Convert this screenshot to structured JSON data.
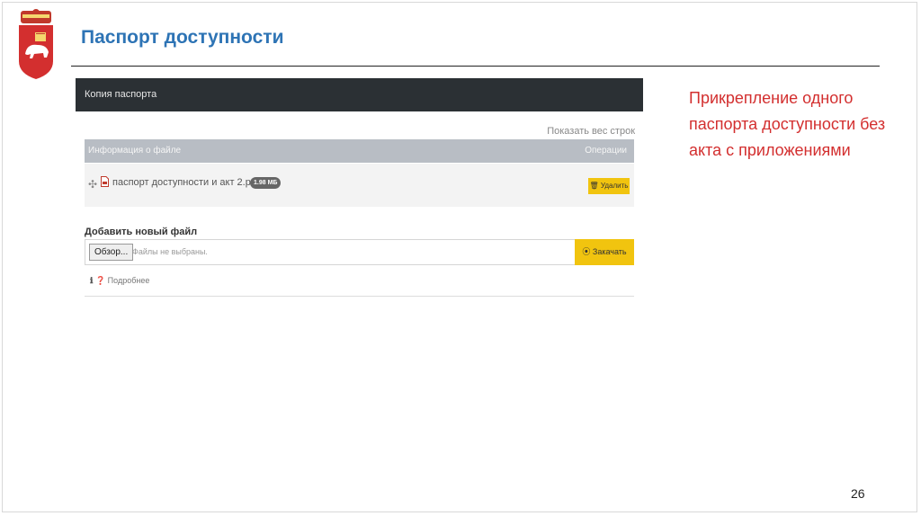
{
  "slide": {
    "title": "Паспорт доступности",
    "note": "Прикрепление одного паспорта доступности без акта с приложениями",
    "page_number": "26"
  },
  "panel": {
    "header": "Копия паспорта",
    "show_all_rows": "Показать вес строк",
    "columns": [
      "Информация о файле",
      "Операции"
    ],
    "file": {
      "name": "паспорт доступности и акт 2.pdf",
      "size": "1.98 МБ",
      "delete_label": "Удалить"
    },
    "add_file_label": "Добавить новый файл",
    "browse_label": "Обзор...",
    "no_file_text": "Файлы не выбраны.",
    "upload_label": "Закачать",
    "more_label": "Подробнее"
  },
  "icons": {
    "crest": "perm-krai-crest-icon",
    "drag": "move-arrows-icon",
    "file": "pdf-file-icon",
    "trash": "trash-icon",
    "upload": "upload-circle-icon",
    "info": "info-icon"
  },
  "colors": {
    "title": "#2e74b5",
    "note": "#d32f2f",
    "header_bg": "#2b3034",
    "table_head_bg": "#b8bdc4",
    "button_yellow": "#f1c40f"
  }
}
